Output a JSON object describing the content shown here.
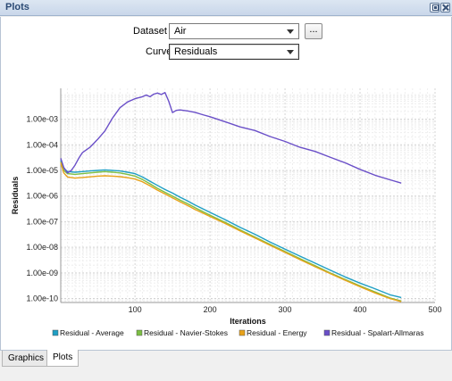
{
  "window": {
    "title": "Plots"
  },
  "controls": {
    "dataset_label": "Dataset",
    "dataset_value": "Air",
    "more_button_label": "...",
    "curve_label": "Curve",
    "curve_value": "Residuals"
  },
  "tabs": [
    {
      "label": "Graphics",
      "active": false
    },
    {
      "label": "Plots",
      "active": true
    }
  ],
  "chart_data": {
    "type": "line",
    "xlabel": "Iterations",
    "ylabel": "Residuals",
    "log_y": true,
    "xlim": [
      1,
      500
    ],
    "ylim": [
      7e-11,
      0.016
    ],
    "xticks": [
      100,
      200,
      300,
      400,
      500
    ],
    "yticks": [
      {
        "value": 1e-10,
        "label": "1.00e-10"
      },
      {
        "value": 1e-09,
        "label": "1.00e-09"
      },
      {
        "value": 1e-08,
        "label": "1.00e-08"
      },
      {
        "value": 1e-07,
        "label": "1.00e-07"
      },
      {
        "value": 1e-06,
        "label": "1.00e-06"
      },
      {
        "value": 1e-05,
        "label": "1.00e-05"
      },
      {
        "value": 0.0001,
        "label": "1.00e-04"
      },
      {
        "value": 0.001,
        "label": "1.00e-03"
      }
    ],
    "grid": true,
    "legend_position": "bottom",
    "series": [
      {
        "name": "Residual - Average",
        "color": "#1f9fc4",
        "x": [
          1,
          5,
          10,
          20,
          30,
          40,
          50,
          60,
          70,
          80,
          90,
          100,
          110,
          120,
          130,
          140,
          150,
          160,
          170,
          180,
          190,
          200,
          220,
          240,
          260,
          280,
          300,
          320,
          340,
          360,
          380,
          400,
          420,
          440,
          455
        ],
        "y": [
          2.5e-05,
          1.2e-05,
          9e-06,
          8.5e-06,
          9e-06,
          9.5e-06,
          1e-05,
          1.05e-05,
          1e-05,
          9.5e-06,
          8.5e-06,
          7.5e-06,
          5.5e-06,
          3.8e-06,
          2.6e-06,
          1.8e-06,
          1.3e-06,
          9e-07,
          6.5e-07,
          4.5e-07,
          3.2e-07,
          2.3e-07,
          1.2e-07,
          6e-08,
          3.2e-08,
          1.6e-08,
          8.5e-09,
          4.5e-09,
          2.4e-09,
          1.3e-09,
          7e-10,
          4e-10,
          2.4e-10,
          1.4e-10,
          1.1e-10
        ]
      },
      {
        "name": "Residual - Navier-Stokes",
        "color": "#7cbf43",
        "x": [
          1,
          5,
          10,
          20,
          30,
          40,
          50,
          60,
          70,
          80,
          90,
          100,
          110,
          120,
          130,
          140,
          150,
          160,
          170,
          180,
          190,
          200,
          220,
          240,
          260,
          280,
          300,
          320,
          340,
          360,
          380,
          400,
          420,
          440,
          455
        ],
        "y": [
          2.2e-05,
          1e-05,
          7.5e-06,
          7e-06,
          7.5e-06,
          8e-06,
          8.5e-06,
          9e-06,
          8.5e-06,
          8e-06,
          7e-06,
          6e-06,
          4.4e-06,
          3e-06,
          2e-06,
          1.4e-06,
          1e-06,
          7e-07,
          5e-07,
          3.5e-07,
          2.5e-07,
          1.8e-07,
          9.5e-08,
          4.8e-08,
          2.5e-08,
          1.3e-08,
          6.8e-09,
          3.6e-09,
          1.9e-09,
          1e-09,
          5.6e-10,
          3.1e-10,
          1.8e-10,
          1.05e-10,
          8e-11
        ]
      },
      {
        "name": "Residual - Energy",
        "color": "#e8a21a",
        "x": [
          1,
          5,
          10,
          20,
          30,
          40,
          50,
          60,
          70,
          80,
          90,
          100,
          110,
          120,
          130,
          140,
          150,
          160,
          170,
          180,
          190,
          200,
          220,
          240,
          260,
          280,
          300,
          320,
          340,
          360,
          380,
          400,
          420,
          440,
          455
        ],
        "y": [
          2e-05,
          8e-06,
          5.5e-06,
          5e-06,
          5.3e-06,
          5.6e-06,
          6e-06,
          6.2e-06,
          6e-06,
          5.7e-06,
          5.2e-06,
          4.6e-06,
          3.6e-06,
          2.5e-06,
          1.7e-06,
          1.2e-06,
          8.5e-07,
          6e-07,
          4.3e-07,
          3e-07,
          2.2e-07,
          1.6e-07,
          8.5e-08,
          4.4e-08,
          2.3e-08,
          1.2e-08,
          6.3e-09,
          3.3e-09,
          1.75e-09,
          9.5e-10,
          5.2e-10,
          2.9e-10,
          1.65e-10,
          1e-10,
          7.5e-11
        ]
      },
      {
        "name": "Residual - Spalart-Allmaras",
        "color": "#6a4fc8",
        "x": [
          1,
          5,
          10,
          15,
          20,
          25,
          30,
          40,
          50,
          60,
          70,
          80,
          90,
          100,
          110,
          115,
          120,
          125,
          130,
          135,
          140,
          145,
          150,
          155,
          160,
          170,
          180,
          190,
          200,
          220,
          240,
          260,
          280,
          300,
          320,
          340,
          360,
          380,
          400,
          420,
          440,
          455
        ],
        "y": [
          3e-05,
          1.3e-05,
          8e-06,
          1e-05,
          1.6e-05,
          3e-05,
          5e-05,
          8e-05,
          0.00016,
          0.00035,
          0.0011,
          0.0028,
          0.0047,
          0.0063,
          0.0075,
          0.0088,
          0.0075,
          0.0095,
          0.0105,
          0.0092,
          0.011,
          0.005,
          0.0018,
          0.0022,
          0.0023,
          0.0021,
          0.00185,
          0.0015,
          0.00125,
          0.0008,
          0.0005,
          0.00036,
          0.00021,
          0.000135,
          8e-05,
          5.5e-05,
          3.3e-05,
          2e-05,
          1.1e-05,
          6.5e-06,
          4.3e-06,
          3.2e-06
        ]
      }
    ]
  }
}
